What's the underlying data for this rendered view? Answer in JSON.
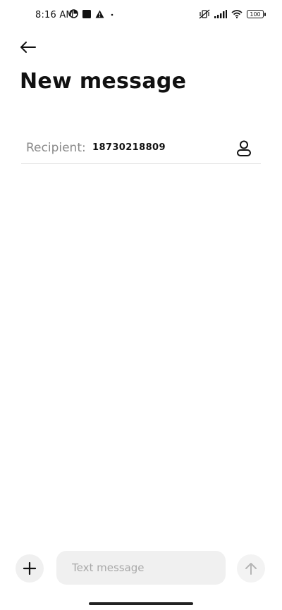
{
  "status_bar": {
    "time": "8:16 AM",
    "battery": "100",
    "left_icons": [
      "data-saver-icon",
      "stop-square-icon",
      "warning-icon",
      "dot-icon"
    ],
    "right_icons": [
      "vibrate-off-icon",
      "signal-icon",
      "wifi-icon",
      "battery-icon"
    ]
  },
  "header": {
    "back_icon": "back-arrow-icon",
    "title": "New message"
  },
  "recipient": {
    "label": "Recipient:",
    "value": "18730218809",
    "contact_icon": "contact-person-icon"
  },
  "composer": {
    "add_icon": "plus-icon",
    "placeholder": "Text message",
    "value": "",
    "send_icon": "send-arrow-up-icon"
  }
}
